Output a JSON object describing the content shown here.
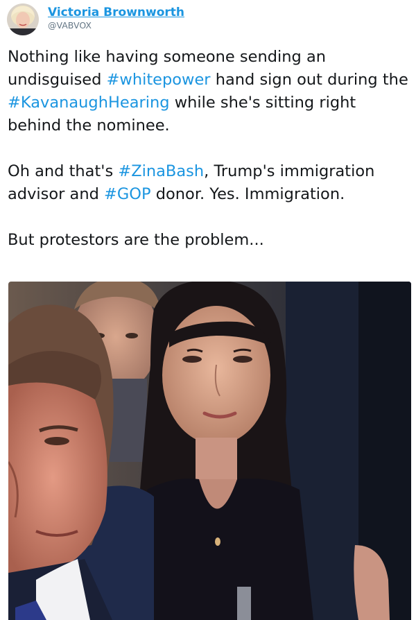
{
  "author": {
    "display_name": "Victoria Brownworth",
    "handle": "@VABVOX",
    "avatar_icon": "profile-photo"
  },
  "tweet": {
    "paragraphs": [
      {
        "segments": [
          {
            "type": "text",
            "text": "Nothing like having someone sending an undisguised "
          },
          {
            "type": "hashtag",
            "text": "#whitepower"
          },
          {
            "type": "text",
            "text": " hand sign out during the "
          },
          {
            "type": "hashtag",
            "text": "#KavanaughHearing"
          },
          {
            "type": "text",
            "text": " while she's sitting right behind the nominee."
          }
        ]
      },
      {
        "segments": [
          {
            "type": "text",
            "text": "Oh and that's "
          },
          {
            "type": "hashtag",
            "text": "#ZinaBash"
          },
          {
            "type": "text",
            "text": ", Trump's immigration advisor and "
          },
          {
            "type": "hashtag",
            "text": "#GOP"
          },
          {
            "type": "text",
            "text": " donor. Yes. Immigration."
          }
        ]
      },
      {
        "segments": [
          {
            "type": "text",
            "text": "But protestors are the problem..."
          }
        ]
      }
    ]
  },
  "colors": {
    "link": "#1b95e0",
    "text": "#14171a",
    "handle": "#657786"
  }
}
